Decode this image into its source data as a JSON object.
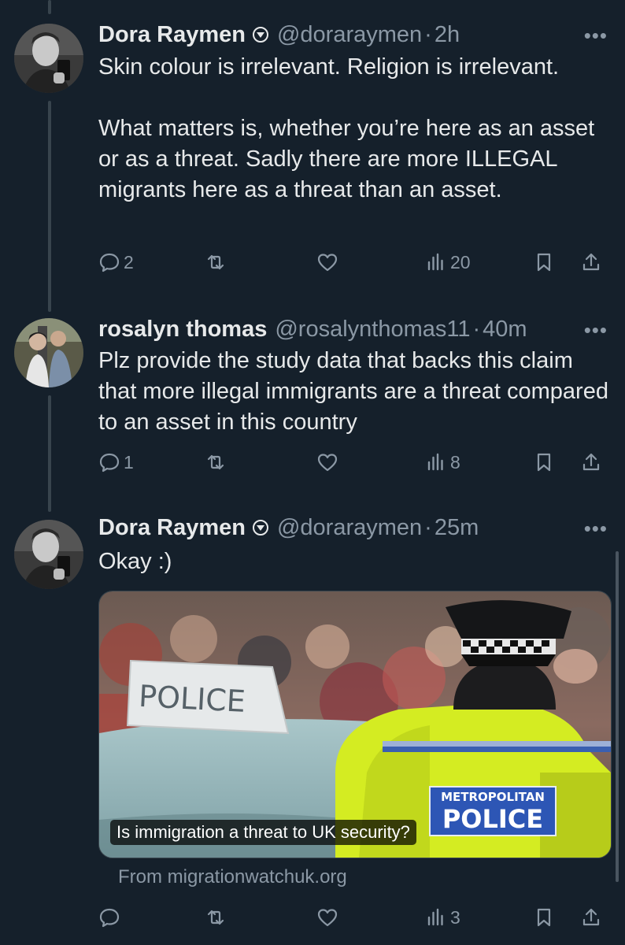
{
  "tweets": [
    {
      "name": "Dora Raymen",
      "handle": "@doraraymen",
      "sep": "·",
      "time": "2h",
      "text": "Skin colour is irrelevant. Religion is irrelevant.\n\nWhat matters is, whether you’re here as an asset or as a threat. Sadly there are more ILLEGAL migrants here as a threat than an asset.",
      "replies": "2",
      "views": "20"
    },
    {
      "name": "rosalyn thomas",
      "handle": "@rosalynthomas11",
      "sep": "·",
      "time": "40m",
      "text": "Plz provide the study data that backs this claim that more illegal immigrants  are a threat compared to an asset in this country",
      "replies": "1",
      "views": "8"
    },
    {
      "name": "Dora Raymen",
      "handle": "@doraraymen",
      "sep": "·",
      "time": "25m",
      "text": "Okay :)",
      "replies": "",
      "views": "3",
      "card": {
        "caption": "Is immigration a threat to UK security?",
        "source": "From migrationwatchuk.org",
        "car_sign": "POLICE",
        "vest_text_top": "METROPOLITAN",
        "vest_text_bottom": "POLICE"
      }
    }
  ],
  "more_label": "•••",
  "colors": {
    "background": "#15202b",
    "text": "#e7e9ea",
    "muted": "#8b98a5",
    "thread_line": "#38444d"
  }
}
